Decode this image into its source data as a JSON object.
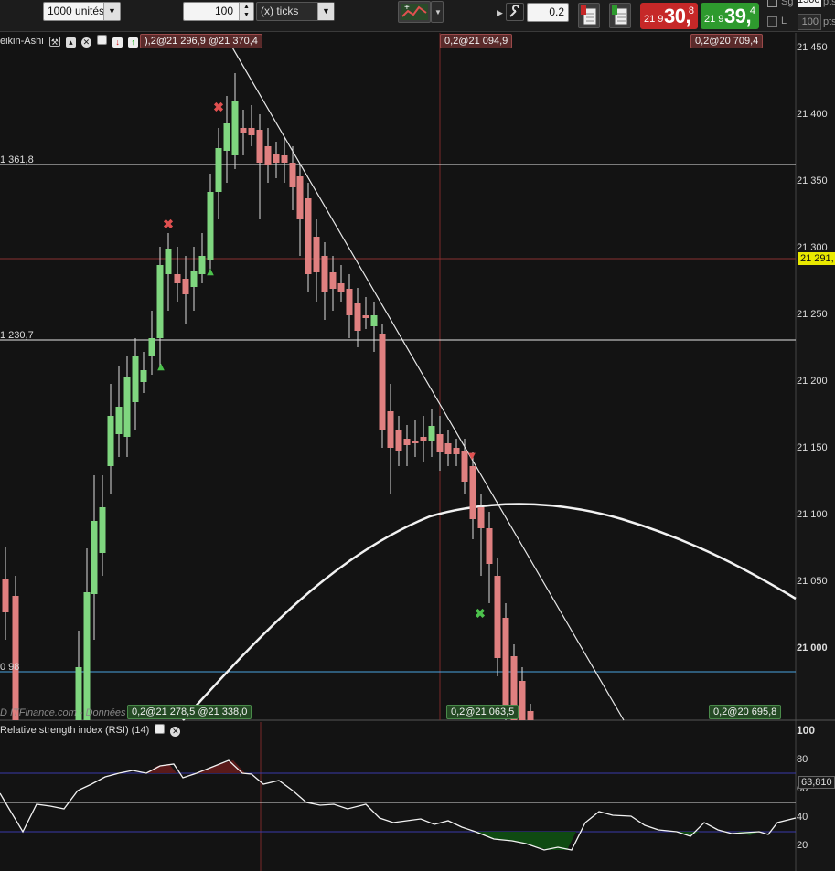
{
  "toolbar": {
    "quantity_select": "1000 unités",
    "offset_value": "100",
    "offset_unit": "(x) ticks",
    "step_value": "0.2",
    "sell": {
      "small": "21 9",
      "big": "30,",
      "sup": "8",
      "color": "#c62828"
    },
    "buy": {
      "small": "21 9",
      "big": "39,",
      "sup": "4",
      "color": "#2e9a2e"
    },
    "sg_label": "Sg",
    "l_label": "L",
    "pts_value": "1500",
    "pts_unit": "pts",
    "pts2_value": "100",
    "pts2_unit": "pts"
  },
  "chart": {
    "title": "eikin-Ashi",
    "rsi_title": "Relative strength index (RSI) (14)",
    "watermark": "D ITFinance.com - Données indicatives",
    "current_price": "21 291,",
    "rsi_current": "63,810",
    "levels": [
      {
        "label": "1 361,8",
        "price": 21361.8,
        "color": "#e6e6e6"
      },
      {
        "label": "1 230,7",
        "price": 21230.7,
        "color": "#e6e6e6"
      },
      {
        "label": "0 98",
        "price": 20983,
        "color": "#4aa3df"
      }
    ],
    "top_tags": [
      {
        "text": "),2@21 296,9 @21 370,4"
      },
      {
        "text": "0,2@21 094,9"
      },
      {
        "text": "0,2@20 709,4"
      }
    ],
    "bottom_tags": [
      {
        "text": "0,2@21 278,5 @21 338,0"
      },
      {
        "text": "0,2@21 063,5"
      },
      {
        "text": "0,2@20 695,8"
      }
    ],
    "colors": {
      "bull": "#7fd67f",
      "bear": "#e08080",
      "bg": "#131313"
    }
  },
  "chart_data": {
    "type": "candlestick",
    "y_axis": [
      "21 450",
      "21 400",
      "21 350",
      "21 300",
      "21 250",
      "21 200",
      "21 150",
      "21 100",
      "21 050",
      "21 000"
    ],
    "rsi_axis": [
      "100",
      "80",
      "60",
      "40",
      "20"
    ],
    "rsi_levels": [
      70,
      30
    ]
  }
}
